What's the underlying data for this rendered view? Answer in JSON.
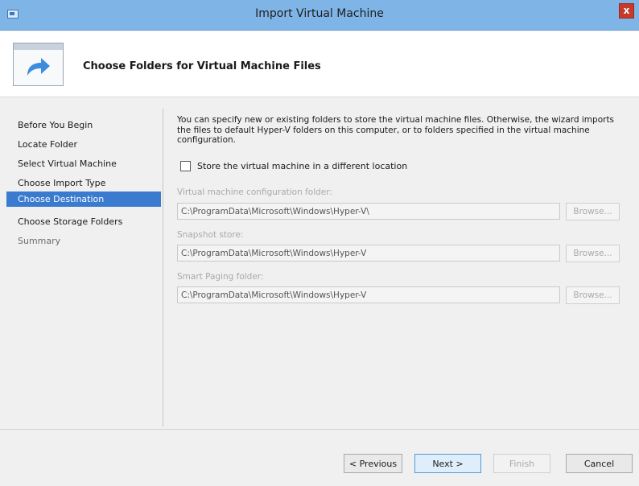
{
  "window": {
    "title": "Import Virtual Machine",
    "close_glyph": "x",
    "app_icon": "window-icon"
  },
  "header": {
    "title": "Choose Folders for Virtual Machine Files",
    "icon": "import-arrow-icon"
  },
  "sidebar": {
    "items": [
      {
        "label": "Before You Begin",
        "state": "normal"
      },
      {
        "label": "Locate Folder",
        "state": "normal"
      },
      {
        "label": "Select Virtual Machine",
        "state": "normal"
      },
      {
        "label": "Choose Import Type",
        "state": "normal"
      },
      {
        "label": "Choose Destination",
        "state": "selected"
      },
      {
        "label": "Choose Storage Folders",
        "state": "normal"
      },
      {
        "label": "Summary",
        "state": "disabled"
      }
    ]
  },
  "content": {
    "description": "You can specify new or existing folders to store the virtual machine files. Otherwise, the wizard imports the files to default Hyper-V folders on this computer, or to folders specified in the virtual machine configuration.",
    "checkbox": {
      "label": "Store the virtual machine in a different location",
      "checked": false
    },
    "fields": [
      {
        "label": "Virtual machine configuration folder:",
        "value": "C:\\ProgramData\\Microsoft\\Windows\\Hyper-V\\",
        "button": "Browse..."
      },
      {
        "label": "Snapshot store:",
        "value": "C:\\ProgramData\\Microsoft\\Windows\\Hyper-V",
        "button": "Browse..."
      },
      {
        "label": "Smart Paging folder:",
        "value": "C:\\ProgramData\\Microsoft\\Windows\\Hyper-V",
        "button": "Browse..."
      }
    ]
  },
  "footer": {
    "previous": "< Previous",
    "next": "Next >",
    "finish": "Finish",
    "cancel": "Cancel"
  },
  "colors": {
    "titlebar": "#7fb5e6",
    "selection": "#3a7bd0",
    "close": "#c7392a",
    "accent_arrow": "#3c8ddc"
  }
}
